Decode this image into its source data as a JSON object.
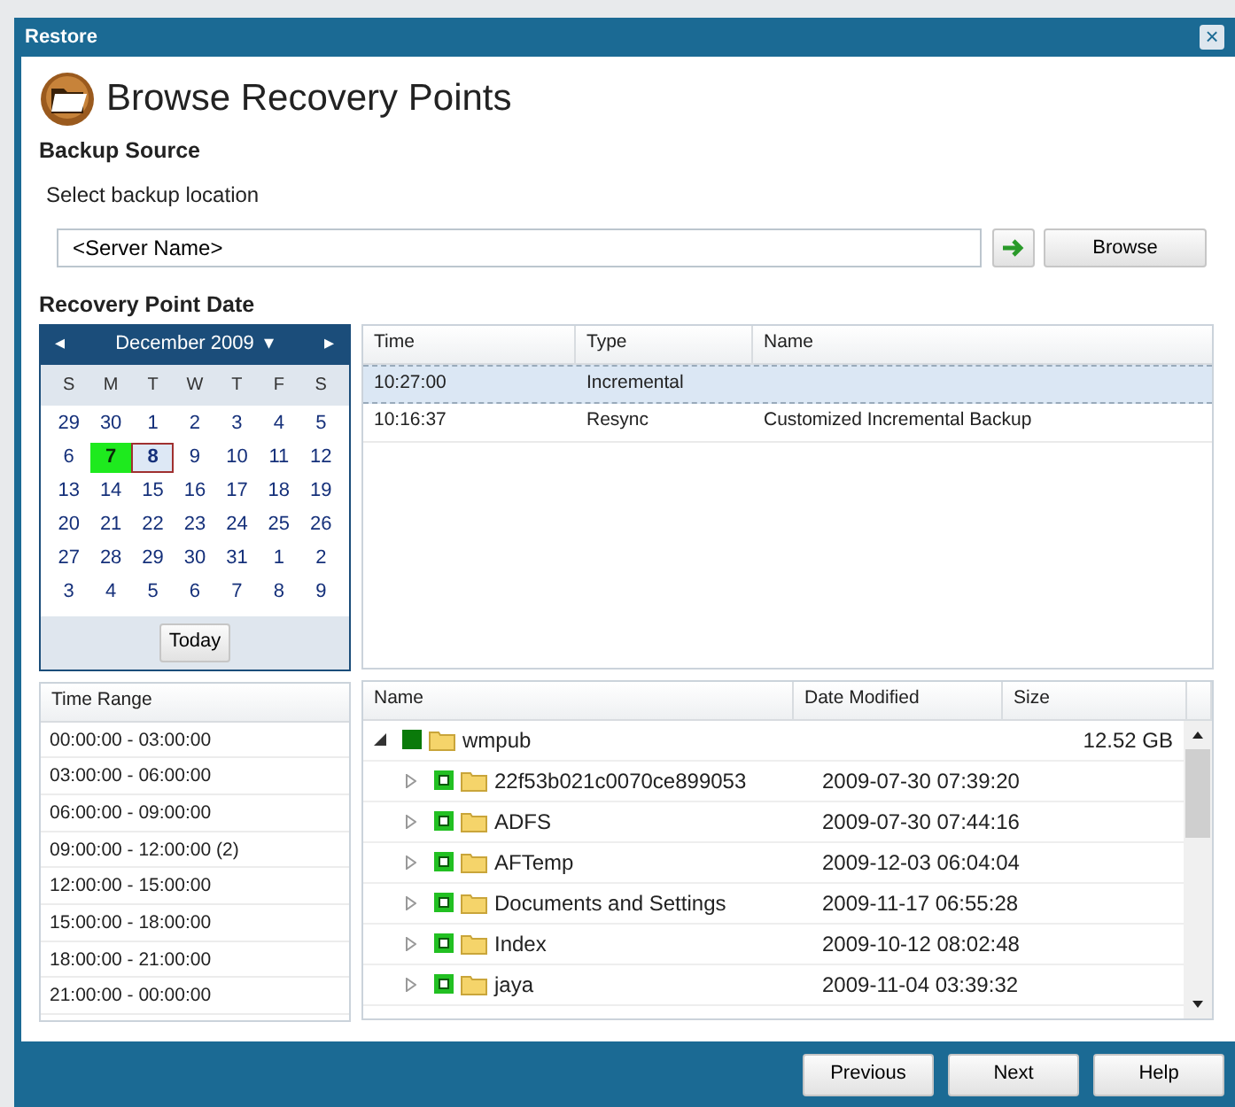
{
  "window": {
    "title": "Restore",
    "close": "×"
  },
  "heading": "Browse Recovery Points",
  "backup_source": {
    "title": "Backup Source",
    "label": "Select backup location",
    "value": "<Server Name>",
    "browse": "Browse"
  },
  "recovery_point_date": {
    "title": "Recovery Point Date"
  },
  "calendar": {
    "prev": "◂",
    "month": "December 2009",
    "dropdown": "▾",
    "next": "▸",
    "weekdays": [
      "S",
      "M",
      "T",
      "W",
      "T",
      "F",
      "S"
    ],
    "weeks": [
      [
        {
          "day": "29",
          "selected": false,
          "has_points": false
        },
        {
          "day": "30",
          "selected": false,
          "has_points": false
        },
        {
          "day": "1",
          "selected": false,
          "has_points": false
        },
        {
          "day": "2",
          "selected": false,
          "has_points": false
        },
        {
          "day": "3",
          "selected": false,
          "has_points": false
        },
        {
          "day": "4",
          "selected": false,
          "has_points": false
        },
        {
          "day": "5",
          "selected": false,
          "has_points": false
        }
      ],
      [
        {
          "day": "6",
          "selected": false,
          "has_points": false
        },
        {
          "day": "7",
          "selected": false,
          "has_points": true
        },
        {
          "day": "8",
          "selected": true,
          "has_points": false
        },
        {
          "day": "9",
          "selected": false,
          "has_points": false
        },
        {
          "day": "10",
          "selected": false,
          "has_points": false
        },
        {
          "day": "11",
          "selected": false,
          "has_points": false
        },
        {
          "day": "12",
          "selected": false,
          "has_points": false
        }
      ],
      [
        {
          "day": "13",
          "selected": false,
          "has_points": false
        },
        {
          "day": "14",
          "selected": false,
          "has_points": false
        },
        {
          "day": "15",
          "selected": false,
          "has_points": false
        },
        {
          "day": "16",
          "selected": false,
          "has_points": false
        },
        {
          "day": "17",
          "selected": false,
          "has_points": false
        },
        {
          "day": "18",
          "selected": false,
          "has_points": false
        },
        {
          "day": "19",
          "selected": false,
          "has_points": false
        }
      ],
      [
        {
          "day": "20",
          "selected": false,
          "has_points": false
        },
        {
          "day": "21",
          "selected": false,
          "has_points": false
        },
        {
          "day": "22",
          "selected": false,
          "has_points": false
        },
        {
          "day": "23",
          "selected": false,
          "has_points": false
        },
        {
          "day": "24",
          "selected": false,
          "has_points": false
        },
        {
          "day": "25",
          "selected": false,
          "has_points": false
        },
        {
          "day": "26",
          "selected": false,
          "has_points": false
        }
      ],
      [
        {
          "day": "27",
          "selected": false,
          "has_points": false
        },
        {
          "day": "28",
          "selected": false,
          "has_points": false
        },
        {
          "day": "29",
          "selected": false,
          "has_points": false
        },
        {
          "day": "30",
          "selected": false,
          "has_points": false
        },
        {
          "day": "31",
          "selected": false,
          "has_points": false
        },
        {
          "day": "1",
          "selected": false,
          "has_points": false
        },
        {
          "day": "2",
          "selected": false,
          "has_points": false
        }
      ],
      [
        {
          "day": "3",
          "selected": false,
          "has_points": false
        },
        {
          "day": "4",
          "selected": false,
          "has_points": false
        },
        {
          "day": "5",
          "selected": false,
          "has_points": false
        },
        {
          "day": "6",
          "selected": false,
          "has_points": false
        },
        {
          "day": "7",
          "selected": false,
          "has_points": false
        },
        {
          "day": "8",
          "selected": false,
          "has_points": false
        },
        {
          "day": "9",
          "selected": false,
          "has_points": false
        }
      ]
    ],
    "today": "Today"
  },
  "points_table": {
    "columns": [
      "Time",
      "Type",
      "Name"
    ],
    "rows": [
      {
        "cells": [
          "10:27:00",
          "Incremental"
        ],
        "selected": true
      },
      {
        "cells": [
          "10:16:37",
          "Resync",
          "Customized Incremental Backup"
        ],
        "selected": false
      }
    ]
  },
  "time_range": {
    "title": "Time Range",
    "rows": [
      "00:00:00 - 03:00:00",
      "03:00:00 - 06:00:00",
      "06:00:00 - 09:00:00",
      "09:00:00 - 12:00:00 (2)",
      "12:00:00 - 15:00:00",
      "15:00:00 - 18:00:00",
      "18:00:00 - 21:00:00",
      "21:00:00 - 00:00:00"
    ]
  },
  "file_tree": {
    "columns": [
      "Name",
      "Date Modified",
      "Size"
    ],
    "items": [
      {
        "name": "wmpub",
        "size": "12.52 GB",
        "expanded": true,
        "fully_checked": true,
        "children": [
          {
            "name": "22f53b021c0070ce899053",
            "date": "2009-07-30 07:39:20",
            "expanded": false,
            "fully_checked": false
          },
          {
            "name": "ADFS",
            "date": "2009-07-30 07:44:16",
            "expanded": false,
            "fully_checked": false
          },
          {
            "name": "AFTemp",
            "date": "2009-12-03 06:04:04",
            "expanded": false,
            "fully_checked": false
          },
          {
            "name": "Documents and Settings",
            "date": "2009-11-17 06:55:28",
            "expanded": false,
            "fully_checked": false
          },
          {
            "name": "Index",
            "date": "2009-10-12 08:02:48",
            "expanded": false,
            "fully_checked": false
          },
          {
            "name": "jaya",
            "date": "2009-11-04 03:39:32",
            "expanded": false,
            "fully_checked": false
          }
        ]
      }
    ]
  },
  "buttons": [
    "Previous",
    "Next",
    "Help"
  ]
}
